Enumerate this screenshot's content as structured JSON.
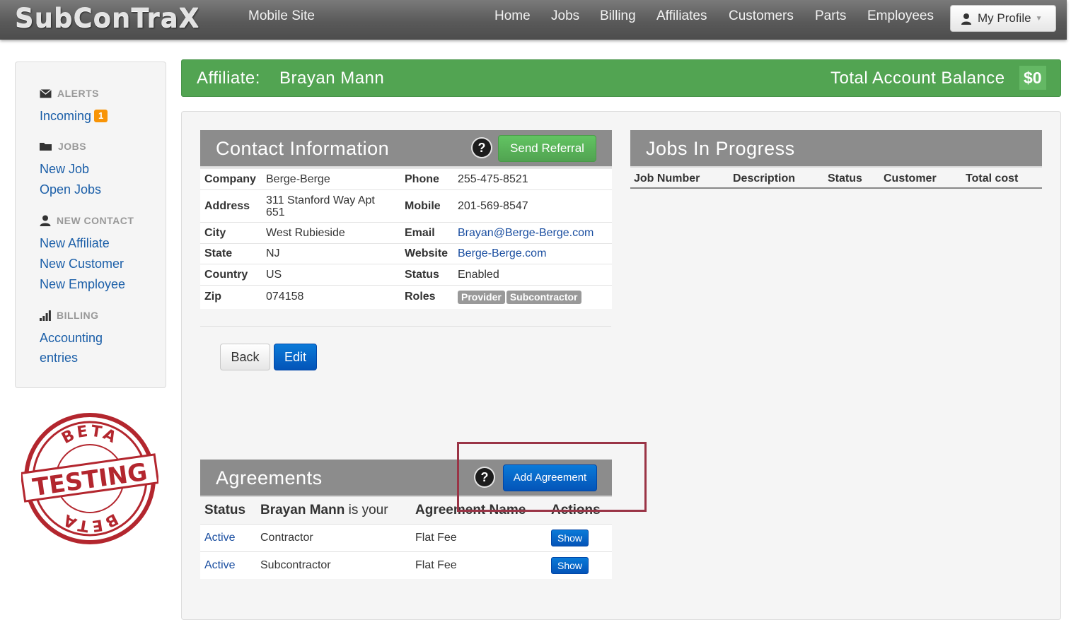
{
  "navbar": {
    "brand": "SubConTraX",
    "mobile_site": "Mobile Site",
    "items": [
      "Home",
      "Jobs",
      "Billing",
      "Affiliates",
      "Customers",
      "Parts",
      "Employees"
    ],
    "profile": "My Profile"
  },
  "sidebar": {
    "alerts_header": "ALERTS",
    "incoming": "Incoming",
    "incoming_count": "1",
    "jobs_header": "JOBS",
    "new_job": "New Job",
    "open_jobs": "Open Jobs",
    "new_contact_header": "NEW CONTACT",
    "new_affiliate": "New Affiliate",
    "new_customer": "New Customer",
    "new_employee": "New Employee",
    "billing_header": "BILLING",
    "accounting": "Accounting",
    "entries": "entries"
  },
  "stamp": {
    "top": "BETA",
    "middle": "TESTING",
    "bottom": "BETA"
  },
  "affiliate_bar": {
    "label": "Affiliate:",
    "name": "Brayan Mann",
    "balance_label": "Total Account Balance",
    "balance": "$0"
  },
  "contact": {
    "title": "Contact Information",
    "help": "?",
    "send_referral": "Send Referral",
    "rows": [
      {
        "l1": "Company",
        "v1": "Berge-Berge",
        "l2": "Phone",
        "v2": "255-475-8521"
      },
      {
        "l1": "Address",
        "v1": "311 Stanford Way Apt 651",
        "l2": "Mobile",
        "v2": "201-569-8547"
      },
      {
        "l1": "City",
        "v1": "West Rubieside",
        "l2": "Email",
        "v2": "Brayan@Berge-Berge.com"
      },
      {
        "l1": "State",
        "v1": "NJ",
        "l2": "Website",
        "v2": "Berge-Berge.com"
      },
      {
        "l1": "Country",
        "v1": "US",
        "l2": "Status",
        "v2": "Enabled"
      },
      {
        "l1": "Zip",
        "v1": "074158",
        "l2": "Roles",
        "v2": ""
      }
    ],
    "roles": [
      "Provider",
      "Subcontractor"
    ],
    "back": "Back",
    "edit": "Edit"
  },
  "jobs": {
    "title": "Jobs In Progress",
    "columns": [
      "Job Number",
      "Description",
      "Status",
      "Customer",
      "Total cost"
    ]
  },
  "agreements": {
    "title": "Agreements",
    "help": "?",
    "add": "Add Agreement",
    "col_status": "Status",
    "col_name_bold": "Brayan Mann",
    "col_name_rest": " is your",
    "col_agreement": "Agreement Name",
    "col_actions": "Actions",
    "rows": [
      {
        "status": "Active",
        "role": "Contractor",
        "agreement": "Flat Fee",
        "action": "Show"
      },
      {
        "status": "Active",
        "role": "Subcontractor",
        "agreement": "Flat Fee",
        "action": "Show"
      }
    ]
  }
}
